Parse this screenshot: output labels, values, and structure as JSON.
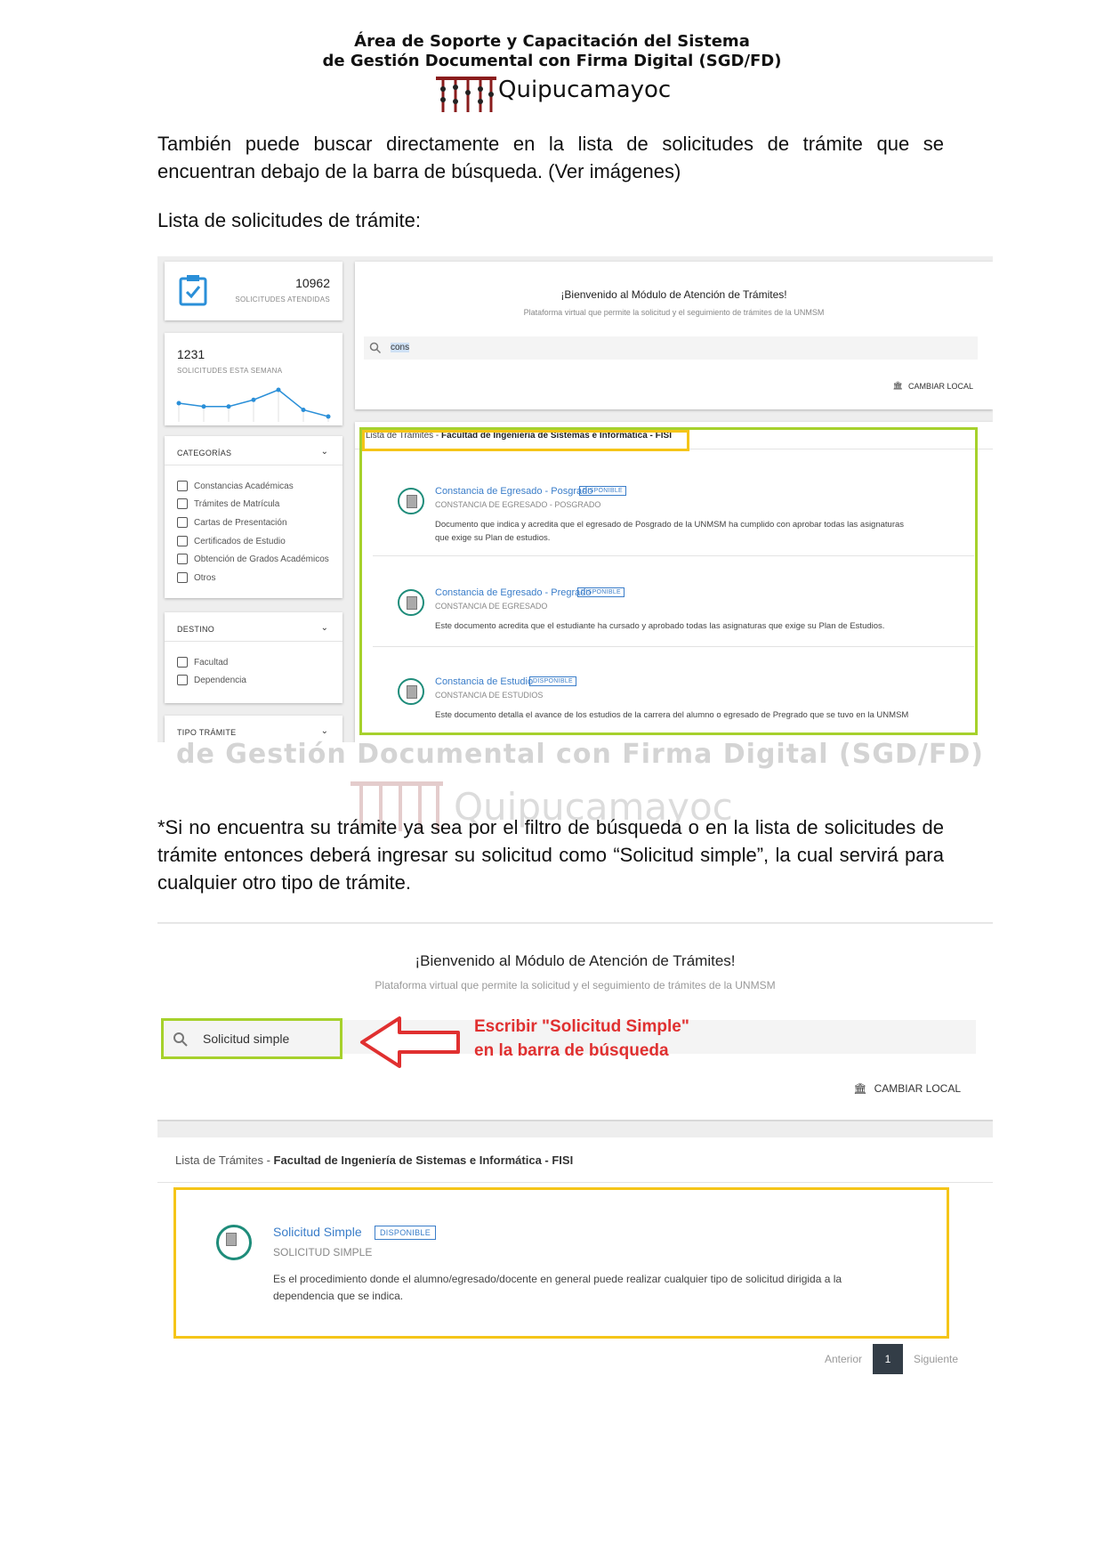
{
  "header": {
    "line1": "Área de Soporte y Capacitación del Sistema",
    "line2": "de Gestión Documental con Firma Digital (SGD/FD)",
    "logo_text": "Quipucamayoc"
  },
  "paragraphs": {
    "p1": "También puede buscar directamente en la lista de solicitudes de trámite que se encuentran debajo de la barra de búsqueda. (Ver imágenes)",
    "p2": "Lista de solicitudes de trámite:",
    "p3": "*Si no encuentra su trámite ya sea por el filtro de búsqueda o en la lista de solicitudes de trámite entonces deberá ingresar su solicitud como “Solicitud simple”, la cual servirá para cualquier otro tipo de trámite."
  },
  "shot1": {
    "stat1_value": "10962",
    "stat1_label": "SOLICITUDES ATENDIDAS",
    "stat2_value": "1231",
    "stat2_label": "SOLICITUDES ESTA SEMANA",
    "categorias_title": "CATEGORÍAS",
    "categorias": [
      "Constancias Académicas",
      "Trámites de Matrícula",
      "Cartas de Presentación",
      "Certificados de Estudio",
      "Obtención de Grados Académicos",
      "Otros"
    ],
    "destino_title": "DESTINO",
    "destino": [
      "Facultad",
      "Dependencia"
    ],
    "tipo_title": "TIPO TRÁMITE",
    "welcome": "¡Bienvenido al Módulo de Atención de Trámites!",
    "subtitle": "Plataforma virtual que permite la solicitud y el seguimiento de trámites de la UNMSM",
    "search_value": "cons",
    "cambiar_local": "CAMBIAR LOCAL",
    "list_prefix": "Lista de Trámites - ",
    "list_faculty": "Facultad de Ingeniería de Sistemas e Informática - FISI",
    "badge": "DISPONIBLE",
    "items": [
      {
        "title": "Constancia de Egresado - Posgrado",
        "sub": "CONSTANCIA DE EGRESADO - POSGRADO",
        "desc": "Documento que indica y acredita que el egresado de Posgrado de la UNMSM ha cumplido con aprobar todas las asignaturas que exige su Plan de estudios."
      },
      {
        "title": "Constancia de Egresado - Pregrado",
        "sub": "CONSTANCIA DE EGRESADO",
        "desc": "Este documento acredita que el estudiante ha cursado y aprobado todas las asignaturas que exige su Plan de Estudios."
      },
      {
        "title": "Constancia de Estudio",
        "sub": "CONSTANCIA DE ESTUDIOS",
        "desc": "Este documento detalla el avance de los estudios de la carrera del alumno o egresado de Pregrado que se tuvo en la UNMSM"
      }
    ],
    "chart_data": {
      "type": "line",
      "values": [
        4,
        3,
        3,
        5,
        8,
        2,
        0
      ]
    }
  },
  "watermark": {
    "line": "de Gestión Documental con Firma Digital (SGD/FD)",
    "logo": "Quipucamayoc"
  },
  "shot2": {
    "welcome": "¡Bienvenido al Módulo de Atención de Trámites!",
    "subtitle": "Plataforma virtual que permite la solicitud y el seguimiento de trámites de la UNMSM",
    "search_value": "Solicitud simple",
    "annotation_line1": "Escribir \"Solicitud Simple\"",
    "annotation_line2": "en la barra de búsqueda",
    "cambiar_local": "CAMBIAR LOCAL",
    "list_prefix": "Lista de Trámites - ",
    "list_faculty": "Facultad de Ingeniería de Sistemas e Informática - FISI",
    "item_title": "Solicitud Simple",
    "badge": "DISPONIBLE",
    "item_sub": "SOLICITUD SIMPLE",
    "item_desc": "Es el procedimiento donde el alumno/egresado/docente en general puede realizar cualquier tipo de solicitud dirigida a la dependencia que se indica.",
    "pager_prev": "Anterior",
    "pager_page": "1",
    "pager_next": "Siguiente"
  },
  "colors": {
    "green_highlight": "#a6d12c",
    "yellow_highlight": "#f5c518",
    "link_blue": "#3a7dc9",
    "annotation_red": "#e03030",
    "icon_teal": "#1e8c7a"
  }
}
